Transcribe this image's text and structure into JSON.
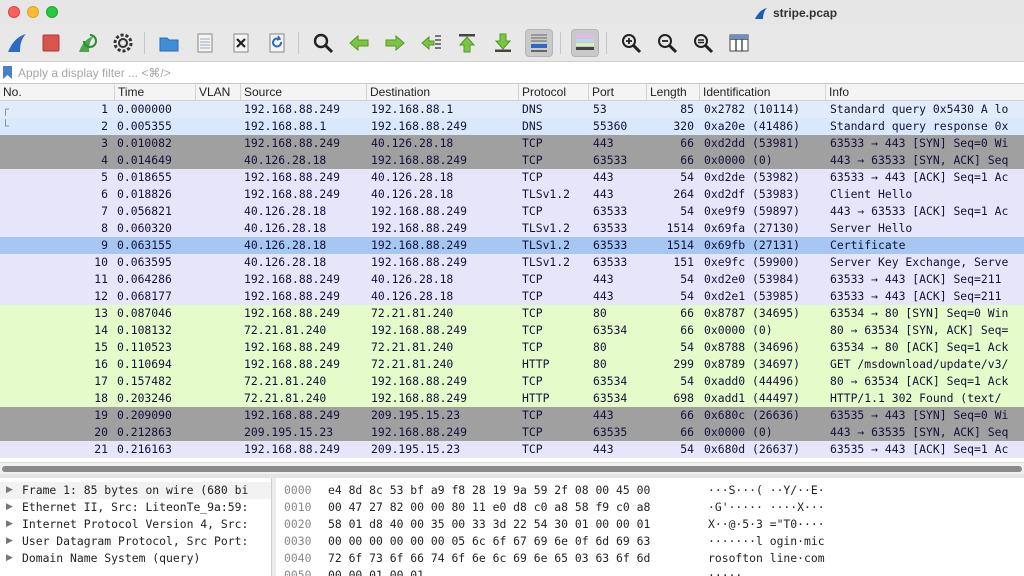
{
  "window": {
    "title": "stripe.pcap"
  },
  "toolbar": {
    "buttons": [
      {
        "name": "start-capture-icon"
      },
      {
        "name": "stop-capture-icon"
      },
      {
        "name": "restart-capture-icon"
      },
      {
        "name": "capture-options-icon"
      },
      {
        "name": "open-file-icon"
      },
      {
        "name": "save-file-icon"
      },
      {
        "name": "close-file-icon"
      },
      {
        "name": "reload-file-icon"
      },
      {
        "name": "find-packet-icon"
      },
      {
        "name": "go-back-icon"
      },
      {
        "name": "go-forward-icon"
      },
      {
        "name": "go-to-packet-icon"
      },
      {
        "name": "go-first-packet-icon"
      },
      {
        "name": "go-last-packet-icon"
      },
      {
        "name": "autoscroll-icon"
      },
      {
        "name": "colorize-icon"
      },
      {
        "name": "zoom-in-icon"
      },
      {
        "name": "zoom-out-icon"
      },
      {
        "name": "normal-size-icon"
      },
      {
        "name": "resize-columns-icon"
      }
    ]
  },
  "filter": {
    "placeholder": "Apply a display filter ... <⌘/>"
  },
  "columns": [
    "No.",
    "Time",
    "VLAN",
    "Source",
    "Destination",
    "Protocol",
    "Port",
    "Length",
    "Identification",
    "Info"
  ],
  "packets": [
    {
      "no": "1",
      "time": "0.000000",
      "src": "192.168.88.249",
      "dst": "192.168.88.1",
      "proto": "DNS",
      "port": "53",
      "len": "85",
      "id": "0x2782 (10114)",
      "info": "Standard query 0x5430 A lo",
      "bg": "#e1ecfb"
    },
    {
      "no": "2",
      "time": "0.005355",
      "src": "192.168.88.1",
      "dst": "192.168.88.249",
      "proto": "DNS",
      "port": "55360",
      "len": "320",
      "id": "0xa20e (41486)",
      "info": "Standard query response 0x",
      "bg": "#dae8fc"
    },
    {
      "no": "3",
      "time": "0.010082",
      "src": "192.168.88.249",
      "dst": "40.126.28.18",
      "proto": "TCP",
      "port": "443",
      "len": "66",
      "id": "0xd2dd (53981)",
      "info": "63533 → 443 [SYN] Seq=0 Wi",
      "bg": "#a0a0a0"
    },
    {
      "no": "4",
      "time": "0.014649",
      "src": "40.126.28.18",
      "dst": "192.168.88.249",
      "proto": "TCP",
      "port": "63533",
      "len": "66",
      "id": "0x0000 (0)",
      "info": "443 → 63533 [SYN, ACK] Seq",
      "bg": "#a0a0a0"
    },
    {
      "no": "5",
      "time": "0.018655",
      "src": "192.168.88.249",
      "dst": "40.126.28.18",
      "proto": "TCP",
      "port": "443",
      "len": "54",
      "id": "0xd2de (53982)",
      "info": "63533 → 443 [ACK] Seq=1 Ac",
      "bg": "#e6e5fa"
    },
    {
      "no": "6",
      "time": "0.018826",
      "src": "192.168.88.249",
      "dst": "40.126.28.18",
      "proto": "TLSv1.2",
      "port": "443",
      "len": "264",
      "id": "0xd2df (53983)",
      "info": "Client Hello",
      "bg": "#e6e5fa"
    },
    {
      "no": "7",
      "time": "0.056821",
      "src": "40.126.28.18",
      "dst": "192.168.88.249",
      "proto": "TCP",
      "port": "63533",
      "len": "54",
      "id": "0xe9f9 (59897)",
      "info": "443 → 63533 [ACK] Seq=1 Ac",
      "bg": "#e6e5fa"
    },
    {
      "no": "8",
      "time": "0.060320",
      "src": "40.126.28.18",
      "dst": "192.168.88.249",
      "proto": "TLSv1.2",
      "port": "63533",
      "len": "1514",
      "id": "0x69fa (27130)",
      "info": "Server Hello",
      "bg": "#e6e5fa"
    },
    {
      "no": "9",
      "time": "0.063155",
      "src": "40.126.28.18",
      "dst": "192.168.88.249",
      "proto": "TLSv1.2",
      "port": "63533",
      "len": "1514",
      "id": "0x69fb (27131)",
      "info": "Certificate",
      "bg": "#a6c7f2"
    },
    {
      "no": "10",
      "time": "0.063595",
      "src": "40.126.28.18",
      "dst": "192.168.88.249",
      "proto": "TLSv1.2",
      "port": "63533",
      "len": "151",
      "id": "0xe9fc (59900)",
      "info": "Server Key Exchange, Serve",
      "bg": "#e6e5fa"
    },
    {
      "no": "11",
      "time": "0.064286",
      "src": "192.168.88.249",
      "dst": "40.126.28.18",
      "proto": "TCP",
      "port": "443",
      "len": "54",
      "id": "0xd2e0 (53984)",
      "info": "63533 → 443 [ACK] Seq=211 ",
      "bg": "#e6e5fa"
    },
    {
      "no": "12",
      "time": "0.068177",
      "src": "192.168.88.249",
      "dst": "40.126.28.18",
      "proto": "TCP",
      "port": "443",
      "len": "54",
      "id": "0xd2e1 (53985)",
      "info": "63533 → 443 [ACK] Seq=211 ",
      "bg": "#e6e5fa"
    },
    {
      "no": "13",
      "time": "0.087046",
      "src": "192.168.88.249",
      "dst": "72.21.81.240",
      "proto": "TCP",
      "port": "80",
      "len": "66",
      "id": "0x8787 (34695)",
      "info": "63534 → 80 [SYN] Seq=0 Win",
      "bg": "#e5fbca"
    },
    {
      "no": "14",
      "time": "0.108132",
      "src": "72.21.81.240",
      "dst": "192.168.88.249",
      "proto": "TCP",
      "port": "63534",
      "len": "66",
      "id": "0x0000 (0)",
      "info": "80 → 63534 [SYN, ACK] Seq=",
      "bg": "#e5fbca"
    },
    {
      "no": "15",
      "time": "0.110523",
      "src": "192.168.88.249",
      "dst": "72.21.81.240",
      "proto": "TCP",
      "port": "80",
      "len": "54",
      "id": "0x8788 (34696)",
      "info": "63534 → 80 [ACK] Seq=1 Ack",
      "bg": "#e5fbca"
    },
    {
      "no": "16",
      "time": "0.110694",
      "src": "192.168.88.249",
      "dst": "72.21.81.240",
      "proto": "HTTP",
      "port": "80",
      "len": "299",
      "id": "0x8789 (34697)",
      "info": "GET /msdownload/update/v3/",
      "bg": "#e5fbca"
    },
    {
      "no": "17",
      "time": "0.157482",
      "src": "72.21.81.240",
      "dst": "192.168.88.249",
      "proto": "TCP",
      "port": "63534",
      "len": "54",
      "id": "0xadd0 (44496)",
      "info": "80 → 63534 [ACK] Seq=1 Ack",
      "bg": "#e5fbca"
    },
    {
      "no": "18",
      "time": "0.203246",
      "src": "72.21.81.240",
      "dst": "192.168.88.249",
      "proto": "HTTP",
      "port": "63534",
      "len": "698",
      "id": "0xadd1 (44497)",
      "info": "HTTP/1.1 302 Found  (text/",
      "bg": "#e5fbca"
    },
    {
      "no": "19",
      "time": "0.209090",
      "src": "192.168.88.249",
      "dst": "209.195.15.23",
      "proto": "TCP",
      "port": "443",
      "len": "66",
      "id": "0x680c (26636)",
      "info": "63535 → 443 [SYN] Seq=0 Wi",
      "bg": "#a0a0a0"
    },
    {
      "no": "20",
      "time": "0.212863",
      "src": "209.195.15.23",
      "dst": "192.168.88.249",
      "proto": "TCP",
      "port": "63535",
      "len": "66",
      "id": "0x0000 (0)",
      "info": "443 → 63535 [SYN, ACK] Seq",
      "bg": "#a0a0a0"
    },
    {
      "no": "21",
      "time": "0.216163",
      "src": "192.168.88.249",
      "dst": "209.195.15.23",
      "proto": "TCP",
      "port": "443",
      "len": "54",
      "id": "0x680d (26637)",
      "info": "63535 → 443 [ACK] Seq=1 Ac",
      "bg": "#e6e5fa"
    }
  ],
  "details": [
    "Frame 1: 85 bytes on wire (680 bi",
    "Ethernet II, Src: LiteonTe_9a:59:",
    "Internet Protocol Version 4, Src:",
    "User Datagram Protocol, Src Port:",
    "Domain Name System (query)"
  ],
  "bytes": [
    {
      "offset": "0000",
      "hex": "e4 8d 8c 53 bf a9 f8 28   19 9a 59 2f 08 00 45 00",
      "ascii": "···S···(  ··Y/··E·"
    },
    {
      "offset": "0010",
      "hex": "00 47 27 82 00 00 80 11   e0 d8 c0 a8 58 f9 c0 a8",
      "ascii": "·G'·····  ····X···"
    },
    {
      "offset": "0020",
      "hex": "58 01 d8 40 00 35 00 33   3d 22 54 30 01 00 00 01",
      "ascii": "X··@·5·3 =\"T0····"
    },
    {
      "offset": "0030",
      "hex": "00 00 00 00 00 00 05 6c   6f 67 69 6e 0f 6d 69 63",
      "ascii": "·······l ogin·mic"
    },
    {
      "offset": "0040",
      "hex": "72 6f 73 6f 66 74 6f 6e   6c 69 6e 65 03 63 6f 6d",
      "ascii": "rosofton line·com"
    },
    {
      "offset": "0050",
      "hex": "00 00 01 00 01",
      "ascii": "·····"
    }
  ]
}
